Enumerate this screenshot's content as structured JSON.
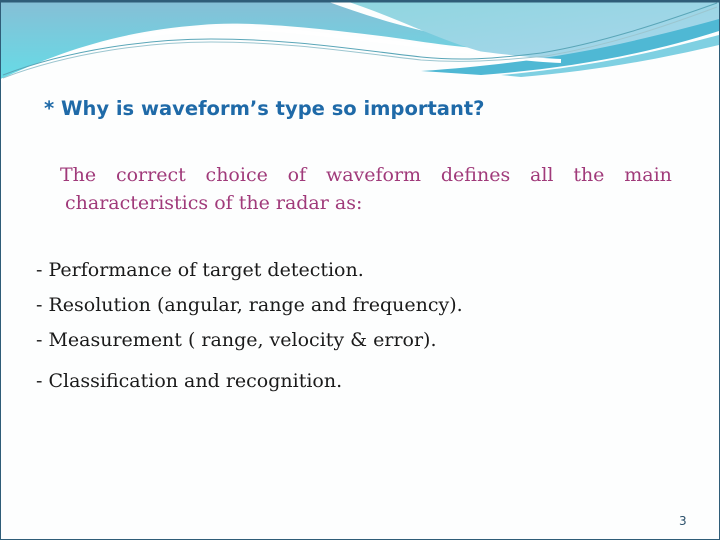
{
  "slide": {
    "title": "* Why is waveform’s type so important?",
    "intro_words_line1": [
      "The",
      "correct",
      "choice",
      "of",
      "waveform",
      "defines",
      "all",
      "the",
      "main"
    ],
    "intro_line2": "characteristics of the radar as:",
    "bullets": [
      "- Performance of target detection.",
      "- Resolution (angular, range and frequency).",
      "- Measurement ( range, velocity & error).",
      "- Classification and recognition."
    ],
    "page_number": "3"
  },
  "colors": {
    "title": "#1f6aa8",
    "intro": "#a03a7a",
    "body": "#1a1a1a",
    "accent_light": "#8fd3e0",
    "accent_mid": "#5bbfd6",
    "border": "#2f5d78"
  }
}
